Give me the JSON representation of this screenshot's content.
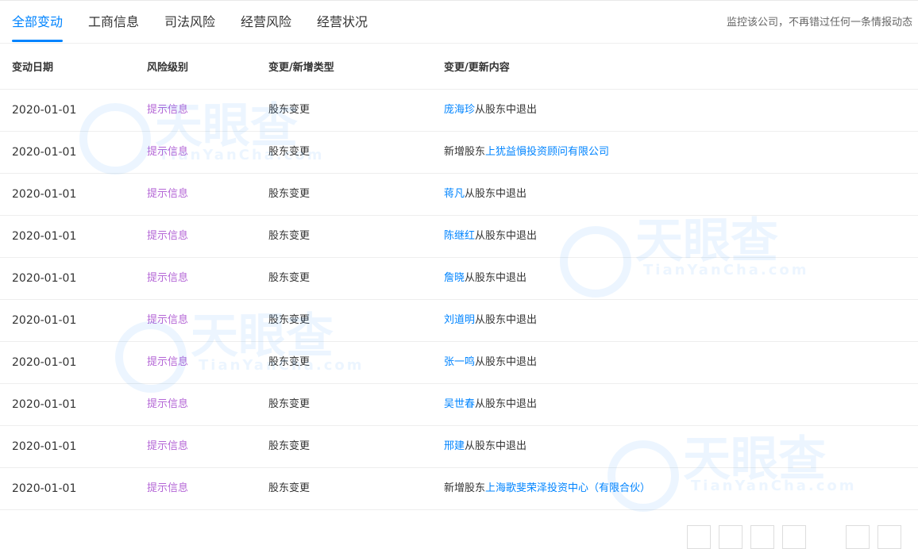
{
  "tabs": [
    {
      "label": "全部变动",
      "active": true
    },
    {
      "label": "工商信息"
    },
    {
      "label": "司法风险"
    },
    {
      "label": "经营风险"
    },
    {
      "label": "经营状况"
    }
  ],
  "promo_text": "监控该公司，不再错过任何一条情报动态",
  "table": {
    "columns": [
      "变动日期",
      "风险级别",
      "变更/新增类型",
      "变更/更新内容"
    ],
    "rows": [
      {
        "date": "2020-01-01",
        "level": "提示信息",
        "type": "股东变更",
        "prefix": "",
        "link": "庞海珍",
        "suffix": "从股东中退出"
      },
      {
        "date": "2020-01-01",
        "level": "提示信息",
        "type": "股东变更",
        "prefix": "新增股东",
        "link": "上犹益愪投资顾问有限公司",
        "suffix": ""
      },
      {
        "date": "2020-01-01",
        "level": "提示信息",
        "type": "股东变更",
        "prefix": "",
        "link": "蒋凡",
        "suffix": "从股东中退出"
      },
      {
        "date": "2020-01-01",
        "level": "提示信息",
        "type": "股东变更",
        "prefix": "",
        "link": "陈继红",
        "suffix": "从股东中退出"
      },
      {
        "date": "2020-01-01",
        "level": "提示信息",
        "type": "股东变更",
        "prefix": "",
        "link": "詹晓",
        "suffix": "从股东中退出"
      },
      {
        "date": "2020-01-01",
        "level": "提示信息",
        "type": "股东变更",
        "prefix": "",
        "link": "刘道明",
        "suffix": "从股东中退出"
      },
      {
        "date": "2020-01-01",
        "level": "提示信息",
        "type": "股东变更",
        "prefix": "",
        "link": "张一鸣",
        "suffix": "从股东中退出"
      },
      {
        "date": "2020-01-01",
        "level": "提示信息",
        "type": "股东变更",
        "prefix": "",
        "link": "吴世春",
        "suffix": "从股东中退出"
      },
      {
        "date": "2020-01-01",
        "level": "提示信息",
        "type": "股东变更",
        "prefix": "",
        "link": "邢建",
        "suffix": "从股东中退出"
      },
      {
        "date": "2020-01-01",
        "level": "提示信息",
        "type": "股东变更",
        "prefix": "新增股东",
        "link": "上海歌斐荣泽投资中心（有限合伙）",
        "suffix": ""
      }
    ]
  },
  "watermark": {
    "cn": "天眼查",
    "en": "TianYanCha.com"
  },
  "colors": {
    "accent": "#0084ff",
    "level": "#b466d6"
  }
}
